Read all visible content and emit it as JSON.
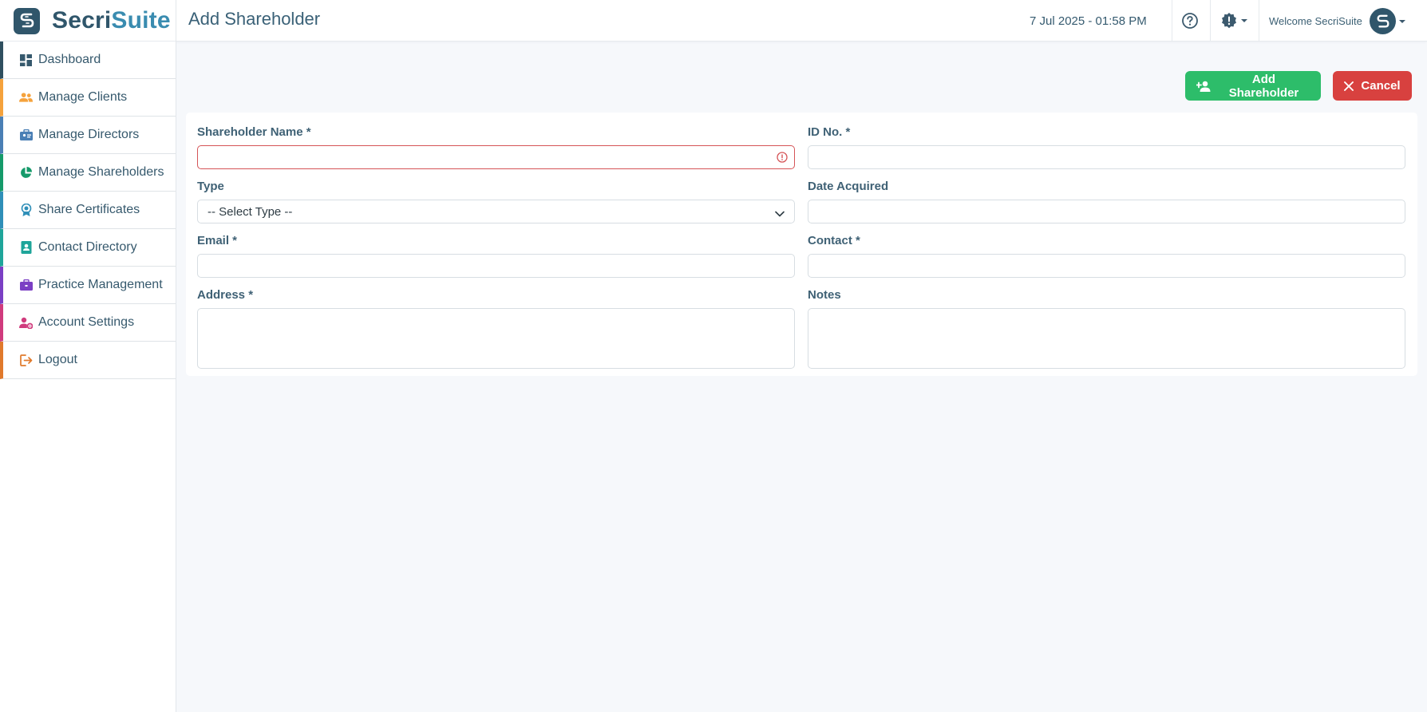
{
  "app": {
    "brand_primary": "Secri",
    "brand_secondary": "Suite",
    "page_title": "Add Shareholder"
  },
  "header": {
    "datetime": "7 Jul 2025 - 01:58 PM",
    "welcome": "Welcome SecriSuite"
  },
  "sidebar": {
    "items": [
      {
        "label": "Dashboard",
        "icon": "dashboard-icon",
        "accent": "#2f4f5f"
      },
      {
        "label": "Manage Clients",
        "icon": "users-icon",
        "accent": "#f5a23c"
      },
      {
        "label": "Manage Directors",
        "icon": "briefcase-badge-icon",
        "accent": "#4a7fb5"
      },
      {
        "label": "Manage Shareholders",
        "icon": "pie-chart-icon",
        "accent": "#159a6a"
      },
      {
        "label": "Share Certificates",
        "icon": "award-icon",
        "accent": "#2f8fb8"
      },
      {
        "label": "Contact Directory",
        "icon": "contact-book-icon",
        "accent": "#1fa59a"
      },
      {
        "label": "Practice Management",
        "icon": "briefcase-icon",
        "accent": "#7b3fc4"
      },
      {
        "label": "Account Settings",
        "icon": "user-gear-icon",
        "accent": "#d03b7d"
      },
      {
        "label": "Logout",
        "icon": "logout-icon",
        "accent": "#e0792b"
      }
    ]
  },
  "actions": {
    "add_label": "Add Shareholder",
    "cancel_label": "Cancel"
  },
  "form": {
    "shareholder_name": {
      "label": "Shareholder Name *",
      "value": ""
    },
    "id_no": {
      "label": "ID No. *",
      "value": ""
    },
    "type": {
      "label": "Type",
      "selected": "-- Select Type --"
    },
    "date_acquired": {
      "label": "Date Acquired",
      "value": ""
    },
    "email": {
      "label": "Email *",
      "value": ""
    },
    "contact": {
      "label": "Contact *",
      "value": ""
    },
    "address": {
      "label": "Address *",
      "value": ""
    },
    "notes": {
      "label": "Notes",
      "value": ""
    }
  },
  "colors": {
    "brand_dark": "#30566b",
    "brand_light": "#3a8cb0",
    "success": "#2dbd6a",
    "danger": "#d8413f",
    "invalid_border": "#d55457"
  }
}
